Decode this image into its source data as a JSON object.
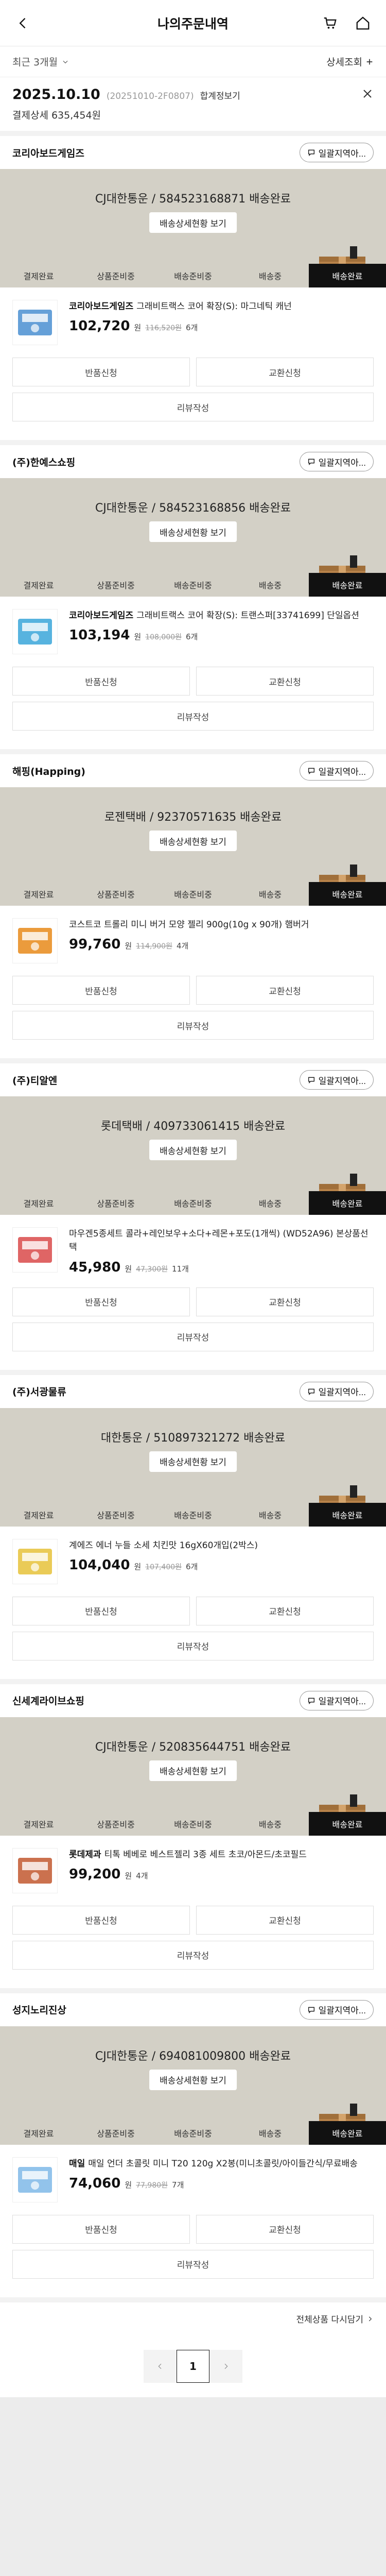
{
  "header": {
    "title": "나의주문내역"
  },
  "filter": {
    "period": "최근 3개월",
    "detail": "상세조회"
  },
  "order": {
    "date": "2025.10.10",
    "period": "(20251010-2F0807)",
    "pay_method": "합계정보기",
    "total": "결제상세 635,454원"
  },
  "ask_label": "일괄지역아...",
  "track_detail_label": "배송상세현황 보기",
  "steps": [
    "결제완료",
    "상품준비중",
    "배송준비중",
    "배송중",
    "배송완료"
  ],
  "action_labels": {
    "return": "반품신청",
    "exchange": "교환신청",
    "review": "리뷰작성"
  },
  "currency_unit": "원",
  "shops": [
    {
      "name": "코리아보드게임즈",
      "tracking": "CJ대한통운 / 584523168871 배송완료",
      "product": {
        "brand": "코리아보드게임즈",
        "name": "그래비트랙스 코어 확장(S): 마그네틱 캐넌",
        "price": "102,720",
        "orig": "116,520원",
        "qty": "6개"
      }
    },
    {
      "name": "(주)한예스쇼핑",
      "tracking": "CJ대한통운 / 584523168856 배송완료",
      "product": {
        "brand": "코리아보드게임즈",
        "name": "그래비트랙스 코어 확장(S): 트랜스퍼[33741699] 단일옵션",
        "price": "103,194",
        "orig": "108,000원",
        "qty": "6개"
      }
    },
    {
      "name": "해핑(Happing)",
      "tracking": "로젠택배 / 92370571635 배송완료",
      "product": {
        "brand": "",
        "name": "코스트코 트롤리 미니 버거 모양 젤리 900g(10g x 90개) 햄버거",
        "price": "99,760",
        "orig": "114,900원",
        "qty": "4개"
      }
    },
    {
      "name": "(주)티알엔",
      "tracking": "롯데택배 / 409733061415 배송완료",
      "product": {
        "brand": "",
        "name": "마우겐5종세트 콜라+레인보우+소다+레몬+포도(1개씩) (WD52A96) 본상품선택",
        "price": "45,980",
        "orig": "47,300원",
        "qty": "11개"
      }
    },
    {
      "name": "(주)서광물류",
      "tracking": "대한통운 / 510897321272 배송완료",
      "product": {
        "brand": "",
        "name": "계에즈 에너 누들 소세 치킨맛 16gX60개입(2박스)",
        "price": "104,040",
        "orig": "107,400원",
        "qty": "6개"
      }
    },
    {
      "name": "신세계라이브쇼핑",
      "tracking": "CJ대한통운 / 520835644751 배송완료",
      "product": {
        "brand": "롯데제과",
        "name": "티톡 베베로 베스트젤리 3종 세트 초코/아몬드/초코필드",
        "price": "99,200",
        "orig": "",
        "qty": "4개"
      }
    },
    {
      "name": "성지노리진상",
      "tracking": "CJ대한통운 / 694081009800 배송완료",
      "product": {
        "brand": "매일",
        "name": "매일 언더 초콜릿 미니 T20 120g X2봉(미니초콜릿/아이들간식/무료배송",
        "price": "74,060",
        "orig": "77,980원",
        "qty": "7개"
      }
    }
  ],
  "view_all": "전체상품 다시담기",
  "pager": {
    "current": "1"
  },
  "colors": {
    "tracking_bg": "#d3d0c6",
    "active_step": "#111111",
    "accent": "#f0502d"
  }
}
